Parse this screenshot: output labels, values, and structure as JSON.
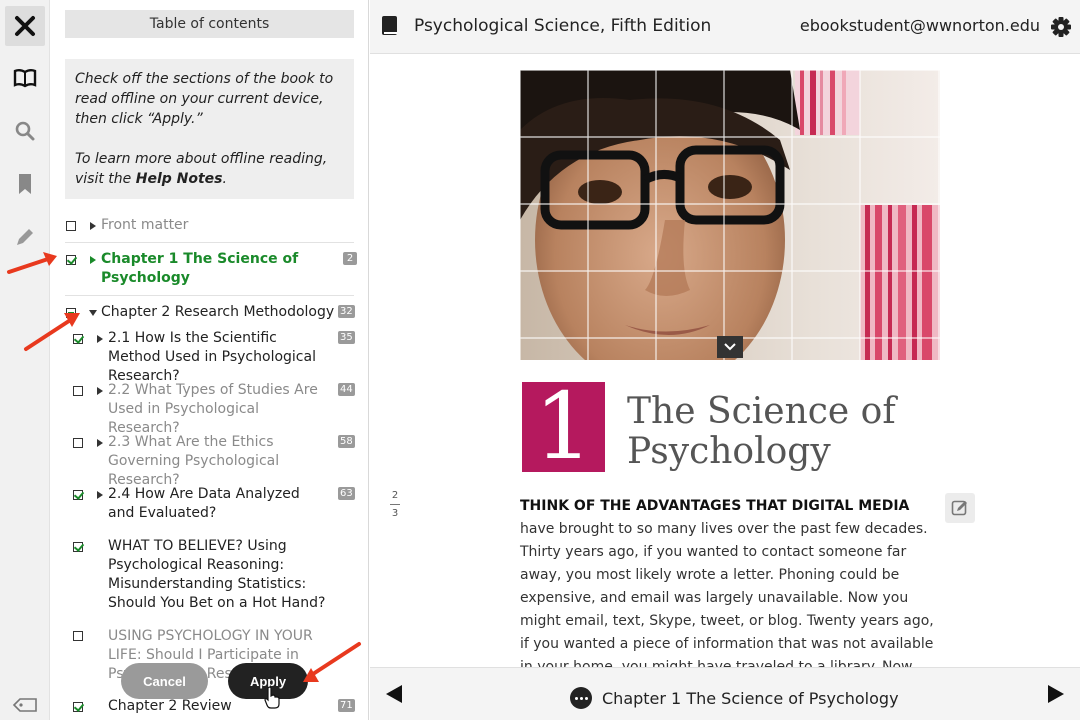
{
  "toc": {
    "title": "Table of contents",
    "help_line1": "Check off the sections of the book to read offline on your current device, then click “Apply.”",
    "help_line2_prefix": "To learn more about offline reading, visit the ",
    "help_link": "Help Notes",
    "help_line2_suffix": ".",
    "entries": [
      {
        "label": "Front matter",
        "checked": false
      },
      {
        "label": "Chapter 1 The Science of Psychology",
        "checked": true,
        "badge": "2"
      },
      {
        "label": "Chapter 2 Research Methodology",
        "checked": "partial",
        "badge": "32"
      },
      {
        "label": "2.1 How Is the Scientific Method Used in Psychological Research?",
        "checked": true,
        "badge": "35"
      },
      {
        "label": "2.2 What Types of Studies Are Used in Psychological Research?",
        "checked": false,
        "badge": "44"
      },
      {
        "label": "2.3 What Are the Ethics Governing Psychological Research?",
        "checked": false,
        "badge": "58"
      },
      {
        "label": "2.4 How Are Data Analyzed and Evaluated?",
        "checked": true,
        "badge": "63"
      },
      {
        "label": "WHAT TO BELIEVE? Using Psychological Reasoning: Misunderstanding Statistics: Should You Bet on a Hot Hand?",
        "checked": true
      },
      {
        "label": "USING PSYCHOLOGY IN YOUR LIFE: Should I Participate in Psychological Research?",
        "checked": false
      },
      {
        "label": "Chapter 2 Review",
        "checked": true,
        "badge": "71"
      }
    ],
    "cancel_label": "Cancel",
    "apply_label": "Apply"
  },
  "header": {
    "book_title": "Psychological Science, Fifth Edition",
    "user_email": "ebookstudent@wwnorton.edu"
  },
  "chapter": {
    "number": "1",
    "title_line1": "The Science of",
    "title_line2": "Psychology",
    "page_current": "2",
    "page_next": "3",
    "lead": "THINK OF THE ADVANTAGES THAT DIGITAL MEDIA",
    "body": " have brought to so many lives over the past few decades. Thirty years ago, if you wanted to contact someone far away, you most likely wrote a letter. Phoning could be expensive, and email was largely unavailable. Now you might email, text, Skype, tweet, or blog. Twenty years ago, if you wanted a piece of information that was not available in your home, you might have traveled to a library. Now you would probably go straight to the Internet."
  },
  "footer": {
    "chapter_label": "Chapter 1 The Science of Psychology"
  },
  "colors": {
    "accent_green": "#1a8a2a",
    "chapter_magenta": "#b5195e",
    "arrow_red": "#e8391e"
  },
  "icons": [
    "close-icon",
    "book-icon",
    "search-icon",
    "bookmark-icon",
    "pencil-icon",
    "tag-icon",
    "settings-gear-icon",
    "more-options-icon",
    "previous-page-icon",
    "next-page-icon",
    "edit-note-icon",
    "chevron-down-icon"
  ]
}
